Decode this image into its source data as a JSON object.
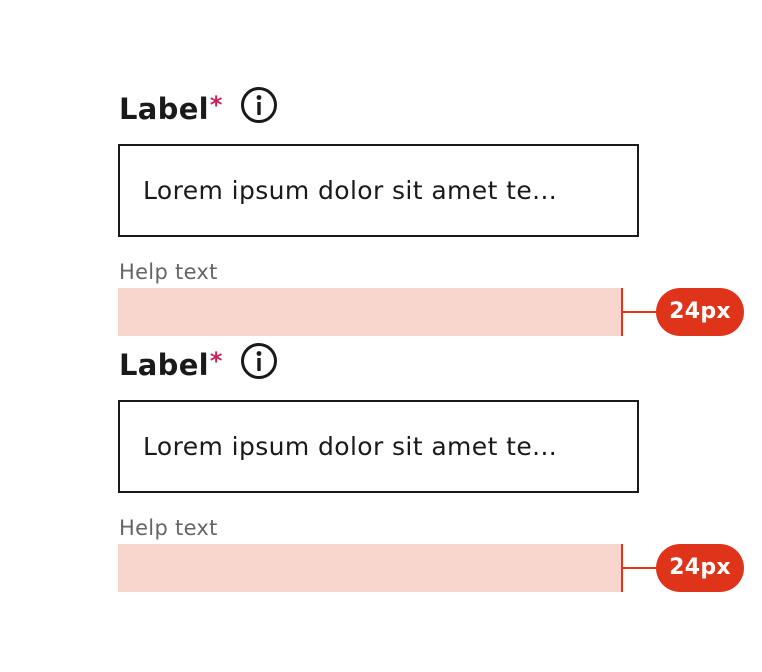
{
  "fields": [
    {
      "label": "Label",
      "required_mark": "*",
      "info_icon": "info-icon",
      "value": "Lorem ipsum dolor sit amet te...",
      "help_text": "Help text",
      "spacing_annotation": "24px"
    },
    {
      "label": "Label",
      "required_mark": "*",
      "info_icon": "info-icon",
      "value": "Lorem ipsum dolor sit amet te...",
      "help_text": "Help text",
      "spacing_annotation": "24px"
    }
  ],
  "colors": {
    "text": "#1a1a1a",
    "required": "#c7245b",
    "help_text": "#666666",
    "spacing_band": "#f7d4cc",
    "annotation_accent": "#e0341a"
  }
}
